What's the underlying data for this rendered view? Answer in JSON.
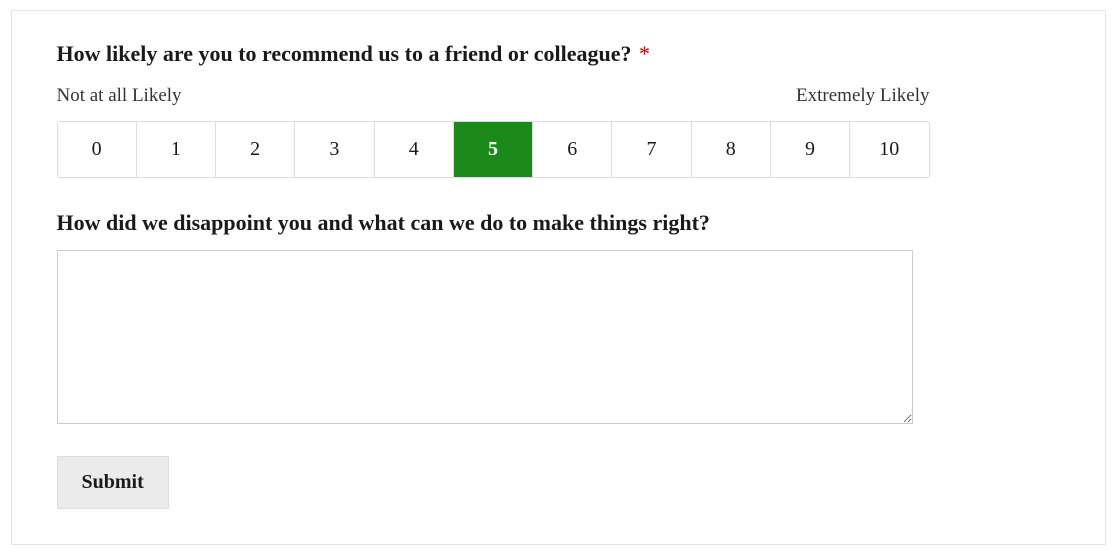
{
  "nps": {
    "question": "How likely are you to recommend us to a friend or colleague?",
    "required_marker": "*",
    "low_label": "Not at all Likely",
    "high_label": "Extremely Likely",
    "options": [
      "0",
      "1",
      "2",
      "3",
      "4",
      "5",
      "6",
      "7",
      "8",
      "9",
      "10"
    ],
    "selected_index": 5
  },
  "followup": {
    "question": "How did we disappoint you and what can we do to make things right?",
    "value": ""
  },
  "submit": {
    "label": "Submit"
  }
}
